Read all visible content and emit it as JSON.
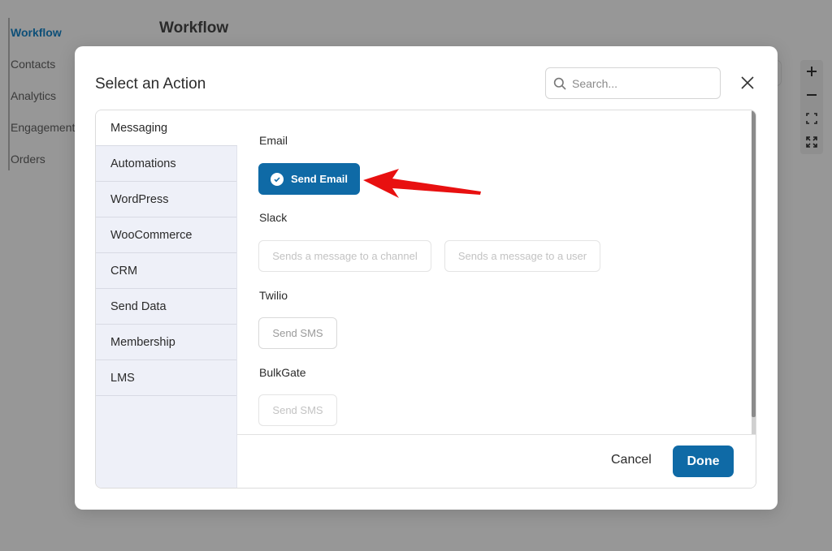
{
  "background": {
    "nav": [
      "Workflow",
      "Contacts",
      "Analytics",
      "Engagement",
      "Orders"
    ],
    "page_title": "Workflow"
  },
  "modal": {
    "title": "Select an Action",
    "search_placeholder": "Search...",
    "categories": [
      "Messaging",
      "Automations",
      "WordPress",
      "WooCommerce",
      "CRM",
      "Send Data",
      "Membership",
      "LMS"
    ],
    "active_category": "Messaging",
    "sections": {
      "email": {
        "title": "Email",
        "actions": [
          "Send Email"
        ]
      },
      "slack": {
        "title": "Slack",
        "actions": [
          "Sends a message to a channel",
          "Sends a message to a user"
        ]
      },
      "twilio": {
        "title": "Twilio",
        "actions": [
          "Send SMS"
        ]
      },
      "bulkgate": {
        "title": "BulkGate",
        "actions": [
          "Send SMS"
        ]
      }
    },
    "selected_action": "Send Email",
    "cancel_label": "Cancel",
    "done_label": "Done"
  },
  "colors": {
    "primary": "#0f6aa6",
    "overlay": "#979797",
    "sidebar_bg": "#eef0f8",
    "annotation_arrow": "#e81010"
  },
  "icons": [
    "search-icon",
    "close-icon",
    "check-circle-icon",
    "plus-icon",
    "minus-icon",
    "fit-view-icon",
    "expand-icon"
  ]
}
